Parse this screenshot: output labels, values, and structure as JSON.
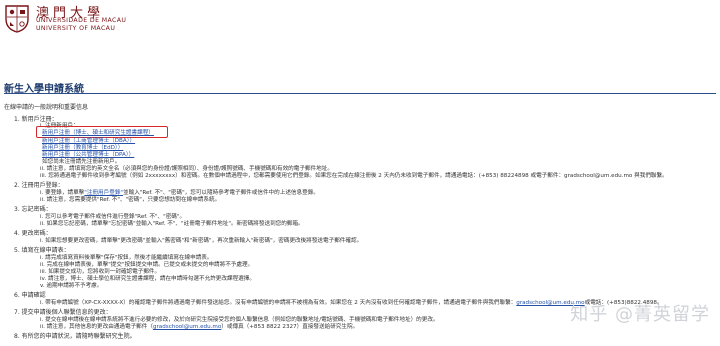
{
  "header": {
    "logo_cn": "澳門大學",
    "logo_pt": "UNIVERSIDADE DE MACAU",
    "logo_en": "UNIVERSITY OF MACAU",
    "brand_color": "#7a1416"
  },
  "page_title": "新生入學申請系統",
  "intro": "在線申請的一般說明和重要信息",
  "sections": {
    "s1": "1. 新用戶注冊：",
    "s1_i": "i. 注冊新用戶：",
    "s1_opts": [
      "新用戶注冊（博士、碩士和研究生證書課程）",
      "新用戶注冊（工商管理博士（DBA））",
      "新用戶注冊（教育博士（EdD））",
      "新用戶注冊（公共管理博士（DPA））",
      "如您尚未注冊請先注冊新用戶。"
    ],
    "s1_ii": "ii. 請注意，請填寫您的英文全名（必須與您的身份證/護照相同）、身份證/護照號碼、手機號碼和有效的電子郵件地址。",
    "s1_iii": "iii. 您將通過電子郵件收到參考編號（例如 2xxxxxxxx）和密碼。在數個申請過程中，您都需要使用它們登錄。如果您在完成在線注冊後 2 天內仍未收到電子郵件，請通過電話：(+853) 88224898 或電子郵件：gradschool@um.edu.mo 與我們聯繫。",
    "s2": "2. 注冊用戶登錄：",
    "s2_i": "i. 要登錄，請單擊",
    "s2_i_link": "\"注冊用戶登錄\"",
    "s2_i_rest": "並輸入\"Ref. 不\"、\"密碼\"，您可以隨時參考電子郵件或信件中的上述信息登錄。",
    "s2_ii": "ii. 請注意，您需要提供\"Ref. 不\"、\"密碼\"，只要您想訪問在線申請系統。",
    "s3": "3. 忘記密碼：",
    "s3_i": "i. 您可以參考電子郵件或信件進行登錄\"Ref. 不\"、\"密碼\"。",
    "s3_ii": "ii. 如果您忘記密碼，請單擊\"忘記密碼\"並輸入\"Ref. 不\"、\"註冊電子郵件地址\"。新密碼將發送到您的郵箱。",
    "s4": "4. 更改密碼：",
    "s4_i": "i. 如果您想要更改密碼，請單擊\"更改密碼\"並輸入\"舊密碼\"和\"新密碼\"，再次重新輸入\"新密碼\"，密碼更改後將發送電子郵件確認。",
    "s5": "5. 填寫在線申請表：",
    "s5_i": "i. 請完成填寫資料後單擊\"保存\"按鈕，然後才能繼續填寫在線申請表。",
    "s5_ii": "ii. 完成在線申請表後，單擊\"提交\"按鈕提交申請。已提交或未提交的申請將不予處理。",
    "s5_iii": "iii. 如果提交成功，您將收到一封確認電子郵件。",
    "s5_iv": "iv. 請注意，博士、碩士學位和研究生證書課程，請在申請時勾選不允許更改課程選擇。",
    "s5_v": "v. 逾期申請將不予考慮。",
    "s6": "6. 申請確認",
    "s6_i": "i. 帶有申請編號（XP-CX-XXXX-X）的確認電子郵件將通過電子郵件發送給您。沒有申請編號的申請將不被視為有效。如果您在 2 天內沒有收到任何確認電子郵件，請通過電子郵件與我們聯繫：",
    "s6_i_link": "gradschool@um.edu.mo",
    "s6_i_rest": "或電話：(+853)8822.4898。",
    "s7": "7. 提交申請後個人聯繫信息的更改：",
    "s7_i": "i. 提交在線申請後在線申請系統將不進行必要的修改，及於向研究生院接受您的個人聯繫信息（例如您的聯繫地址/電話號碼、手機號碼和電子郵件地址）的更改。",
    "s7_ii": "ii. 請注意，其他信息的更改由通過電子郵件（",
    "s7_ii_link": "gradschool@um.edu.mo",
    "s7_ii_rest": "）或傳真（+853 8822 2327）直接發送給研究生院。",
    "s8": "8. 有所您的申請狀況，請隨時聯繫研究生院。"
  },
  "watermark": "知乎 @菁英留学",
  "colors": {
    "title": "#1d3b6e",
    "link": "#2450a8",
    "highlight": "#d22a2a"
  }
}
